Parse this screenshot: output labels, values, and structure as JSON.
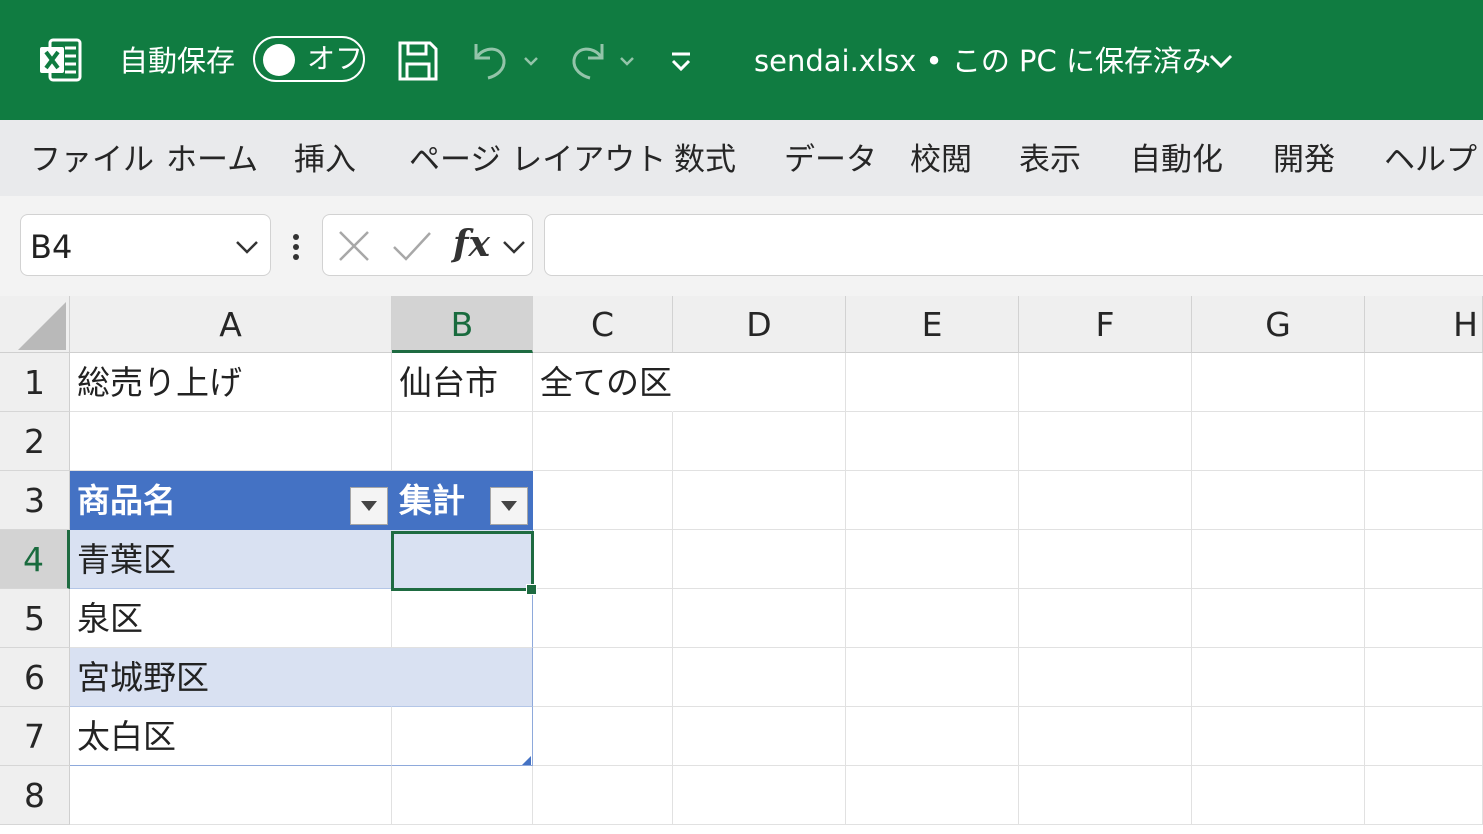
{
  "titlebar": {
    "app_icon": "excel-logo-icon",
    "autosave_label": "自動保存",
    "autosave_state": "オフ",
    "icons": [
      "save-icon",
      "undo-icon",
      "redo-icon",
      "customize-qat-icon"
    ],
    "document_title": "sendai.xlsx • この PC に保存済み",
    "background_color": "#107c41"
  },
  "ribbon": {
    "tabs": [
      "ファイル",
      "ホーム",
      "挿入",
      "ページ レイアウト",
      "数式",
      "データ",
      "校閲",
      "表示",
      "自動化",
      "開発",
      "ヘルプ"
    ]
  },
  "formula_bar": {
    "name_box": "B4",
    "fx_label": "fx",
    "formula": ""
  },
  "sheet": {
    "columns": [
      "A",
      "B",
      "C",
      "D",
      "E",
      "F",
      "G",
      "H"
    ],
    "rows": [
      "1",
      "2",
      "3",
      "4",
      "5",
      "6",
      "7",
      "8"
    ],
    "selected_cell": "B4",
    "cells": {
      "A1": "総売り上げ",
      "B1": "仙台市",
      "C1": "全ての区",
      "A3": "商品名",
      "B3": "集計",
      "A4": "青葉区",
      "A5": "泉区",
      "A6": "宮城野区",
      "A7": "太白区"
    },
    "table_header_color": "#4472c4",
    "table_band_color": "#d9e1f2",
    "selection_color": "#1e6b41"
  }
}
